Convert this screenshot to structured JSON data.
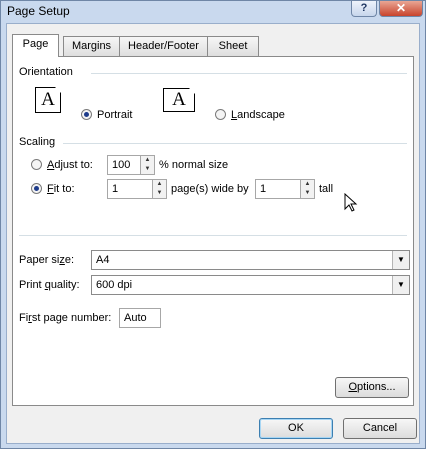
{
  "window": {
    "title": "Page Setup",
    "help_glyph": "?",
    "close_glyph": "✕"
  },
  "tabs": [
    {
      "label": "Page",
      "active": true
    },
    {
      "label": "Margins",
      "active": false
    },
    {
      "label": "Header/Footer",
      "active": false
    },
    {
      "label": "Sheet",
      "active": false
    }
  ],
  "orientation": {
    "label": "Orientation",
    "portrait": {
      "icon_letter": "A",
      "label_pre": "",
      "label_accel": "",
      "label_post": "Portrait",
      "selected": true
    },
    "landscape": {
      "icon_letter": "A",
      "label_pre": "",
      "label_accel": "L",
      "label_post": "andscape",
      "selected": false
    }
  },
  "scaling": {
    "label": "Scaling",
    "adjust": {
      "accel": "A",
      "rest": "djust to:",
      "value": "100",
      "suffix": "% normal size",
      "selected": false
    },
    "fit": {
      "accel": "F",
      "rest": "it to:",
      "wide_value": "1",
      "wide_label": "page(s) wide by",
      "tall_value": "1",
      "tall_label": "tall",
      "selected": true
    }
  },
  "paper": {
    "size_pre": "Paper si",
    "size_accel": "z",
    "size_post": "e:",
    "size_value": "A4",
    "quality_pre": "Print ",
    "quality_accel": "q",
    "quality_post": "uality:",
    "quality_value": "600 dpi",
    "first_pre": "Fi",
    "first_accel": "r",
    "first_post": "st page number:",
    "first_value": "Auto"
  },
  "buttons": {
    "options_pre": "",
    "options_accel": "O",
    "options_post": "ptions...",
    "ok": "OK",
    "cancel": "Cancel"
  },
  "spin_up": "▲",
  "spin_down": "▼",
  "dropdown_arrow": "▼"
}
